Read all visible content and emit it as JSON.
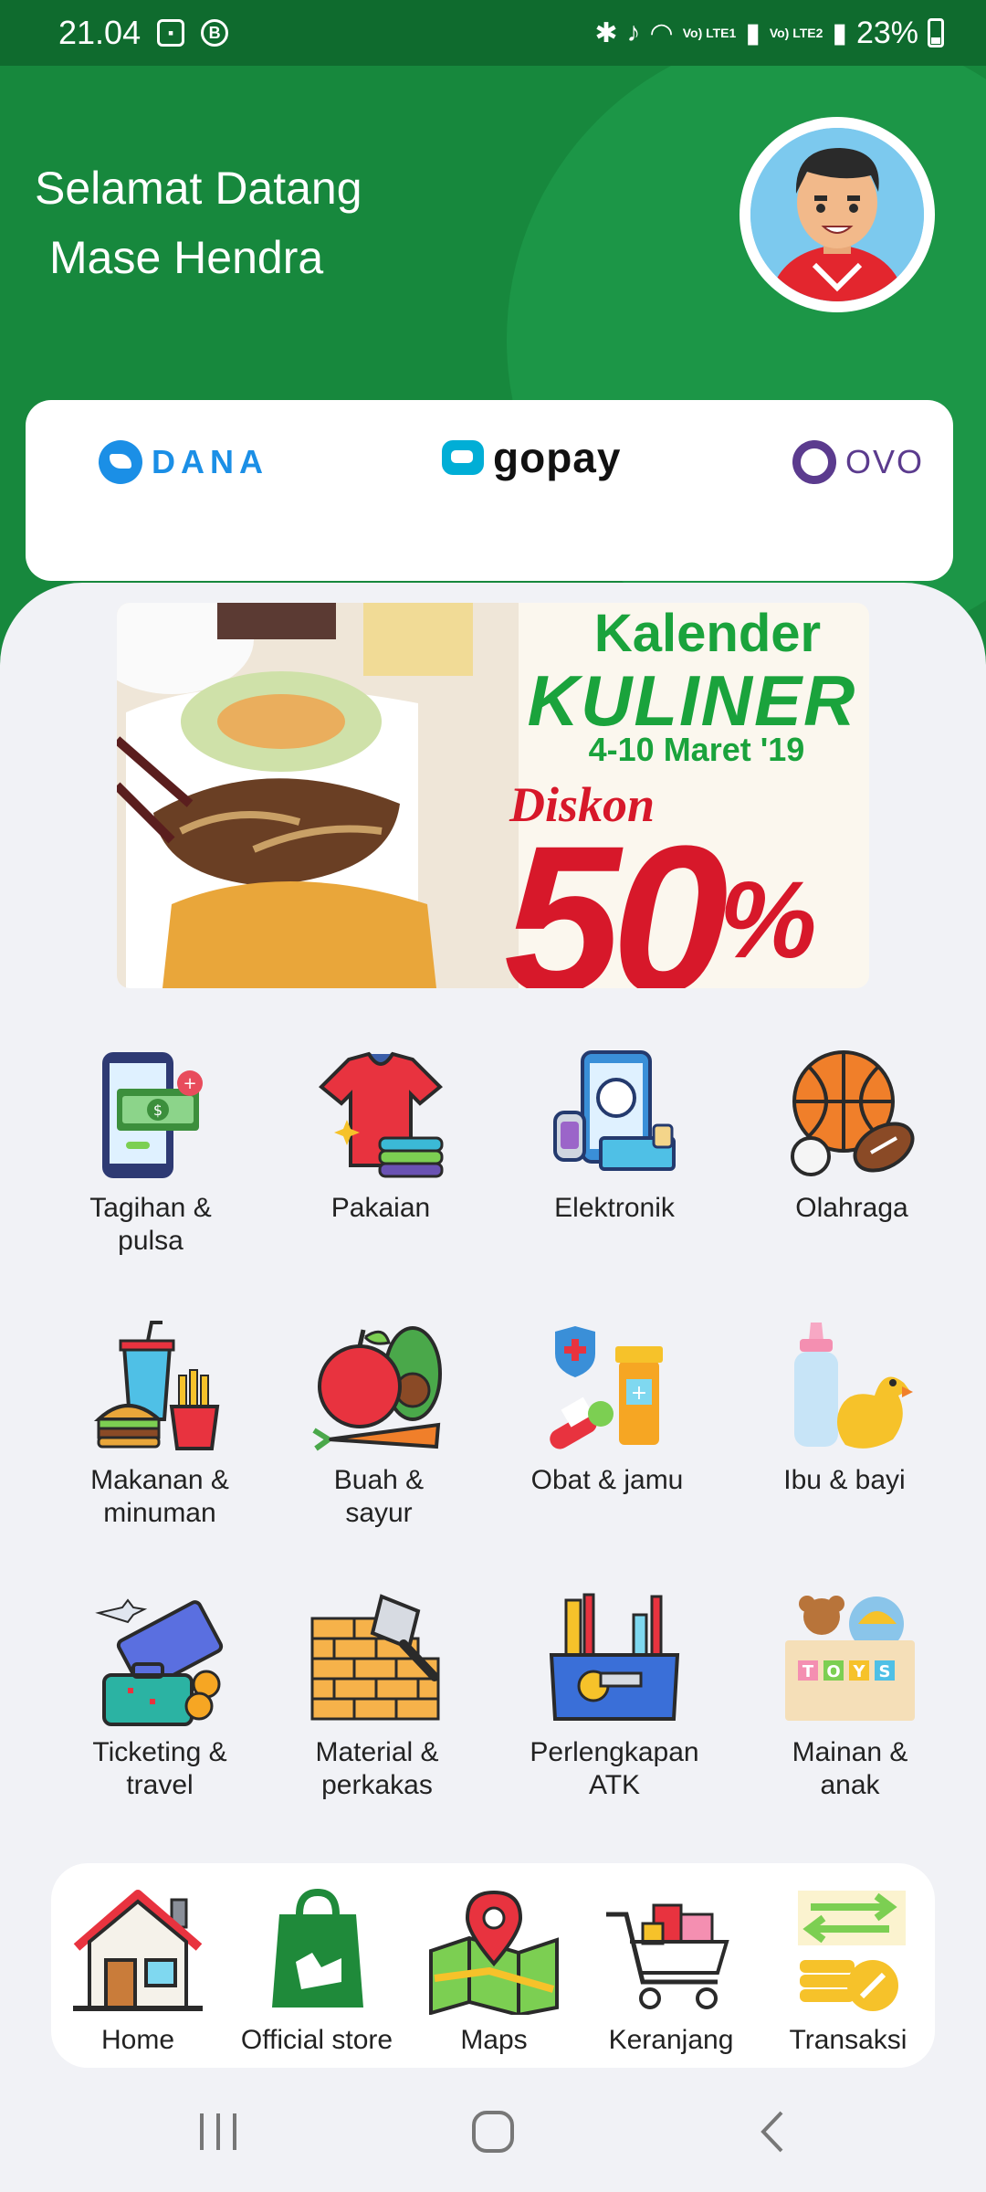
{
  "status_bar": {
    "time": "21.04",
    "sim1": "Vo) LTE1",
    "sim2": "Vo) LTE2",
    "battery": "23%"
  },
  "header": {
    "greeting_line1": "Selamat Datang",
    "greeting_line2": "Mase Hendra"
  },
  "wallets": [
    {
      "name": "DANA",
      "icon": "dana-logo"
    },
    {
      "name": "gopay",
      "icon": "gopay-logo"
    },
    {
      "name": "OVO",
      "icon": "ovo-logo"
    }
  ],
  "banner": {
    "title_top": "Kalender",
    "title_main": "KULINER",
    "date": "4-10 Maret '19",
    "discount_label": "Diskon",
    "discount_value": "50",
    "discount_unit": "%"
  },
  "categories": [
    {
      "label": "Tagihan &\npulsa",
      "icon": "bill-phone-icon"
    },
    {
      "label": "Pakaian",
      "icon": "shirt-icon"
    },
    {
      "label": "Elektronik",
      "icon": "electronics-icon"
    },
    {
      "label": "Olahraga",
      "icon": "sports-balls-icon"
    },
    {
      "label": "Makanan &\nminuman",
      "icon": "fast-food-icon"
    },
    {
      "label": "Buah &\nsayur",
      "icon": "fruit-vegetable-icon"
    },
    {
      "label": "Obat & jamu",
      "icon": "medicine-icon"
    },
    {
      "label": "Ibu & bayi",
      "icon": "baby-bottle-duck-icon"
    },
    {
      "label": "Ticketing &\ntravel",
      "icon": "travel-ticket-icon"
    },
    {
      "label": "Material &\nperkakas",
      "icon": "brick-trowel-icon"
    },
    {
      "label": "Perlengkapan\nATK",
      "icon": "stationery-icon"
    },
    {
      "label": "Mainan &\nanak",
      "icon": "toys-box-icon"
    }
  ],
  "bottom_nav": [
    {
      "label": "Home",
      "icon": "house-icon"
    },
    {
      "label": "Official store",
      "icon": "shopping-bag-icon"
    },
    {
      "label": "Maps",
      "icon": "map-pin-icon"
    },
    {
      "label": "Keranjang",
      "icon": "shopping-cart-icon"
    },
    {
      "label": "Transaksi",
      "icon": "transaction-icon"
    }
  ],
  "colors": {
    "header_green": "#17883d",
    "status_green": "#0f6b2e",
    "background": "#f1f2f6",
    "banner_green": "#1aa33c",
    "banner_red": "#d7182a"
  }
}
